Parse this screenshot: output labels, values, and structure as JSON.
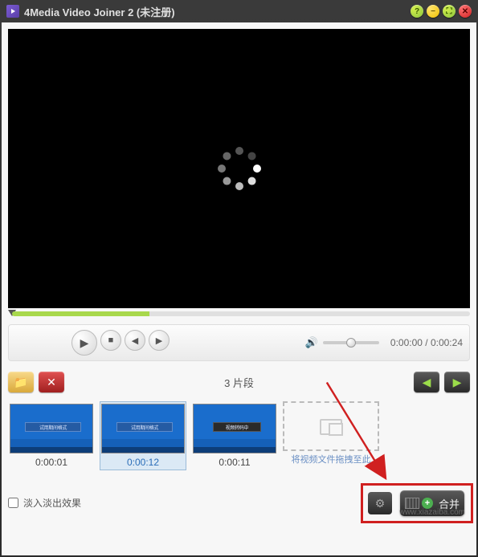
{
  "app": {
    "title": "4Media Video Joiner 2 (未注册)"
  },
  "playback": {
    "current_time": "0:00:00",
    "total_time": "0:00:24",
    "time_separator": " / "
  },
  "clips": {
    "count_label": "3 片段",
    "items": [
      {
        "duration": "0:00:01"
      },
      {
        "duration": "0:00:12"
      },
      {
        "duration": "0:00:11"
      }
    ],
    "dropzone_hint": "将视频文件拖拽至此"
  },
  "options": {
    "fade_label": "淡入淡出效果"
  },
  "actions": {
    "merge_label": "合并"
  },
  "watermark": "www.xiazaiba.com"
}
